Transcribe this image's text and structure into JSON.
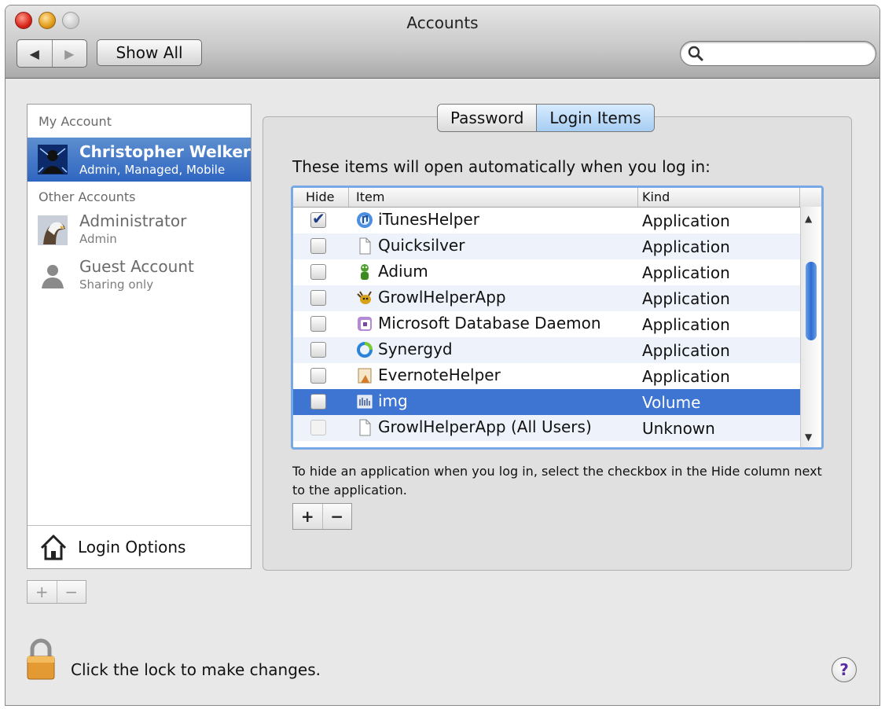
{
  "window": {
    "title": "Accounts"
  },
  "toolbar": {
    "back_icon": "left-triangle-icon",
    "forward_icon": "right-triangle-icon",
    "show_all_label": "Show All",
    "search": {
      "value": "",
      "placeholder": ""
    }
  },
  "accounts": {
    "my_account_header": "My Account",
    "current": {
      "name": "Christopher Welker",
      "subtitle": "Admin, Managed, Mobile"
    },
    "other_header": "Other Accounts",
    "others": [
      {
        "name": "Administrator",
        "subtitle": "Admin"
      },
      {
        "name": "Guest Account",
        "subtitle": "Sharing only"
      }
    ],
    "login_options_label": "Login Options",
    "add_label": "+",
    "remove_label": "−"
  },
  "tabs": [
    {
      "label": "Password",
      "active": false
    },
    {
      "label": "Login Items",
      "active": true
    }
  ],
  "login_items": {
    "intro": "These items will open automatically when you log in:",
    "columns": {
      "hide": "Hide",
      "item": "Item",
      "kind": "Kind"
    },
    "rows": [
      {
        "hide": true,
        "name": "iTunesHelper",
        "kind": "Application",
        "icon": "itunes-icon"
      },
      {
        "hide": false,
        "name": "Quicksilver",
        "kind": "Application",
        "icon": "document-icon"
      },
      {
        "hide": false,
        "name": "Adium",
        "kind": "Application",
        "icon": "adium-icon"
      },
      {
        "hide": false,
        "name": "GrowlHelperApp",
        "kind": "Application",
        "icon": "growl-icon"
      },
      {
        "hide": false,
        "name": "Microsoft Database Daemon",
        "kind": "Application",
        "icon": "database-icon"
      },
      {
        "hide": false,
        "name": "Synergyd",
        "kind": "Application",
        "icon": "synergy-icon"
      },
      {
        "hide": false,
        "name": "EvernoteHelper",
        "kind": "Application",
        "icon": "evernote-icon"
      },
      {
        "hide": false,
        "name": "img",
        "kind": "Volume",
        "icon": "volume-icon",
        "selected": true
      },
      {
        "hide": false,
        "name": "GrowlHelperApp (All Users)",
        "kind": "Unknown",
        "icon": "document-icon",
        "disabled": true
      }
    ],
    "hint": "To hide an application when you log in, select the checkbox in the Hide column next to the application.",
    "add_label": "+",
    "remove_label": "−"
  },
  "footer": {
    "lock_text": "Click the lock to make changes.",
    "help_label": "?"
  },
  "colors": {
    "selection": "#3e74d2",
    "accent": "#78a9e6",
    "help": "#5b2da0"
  }
}
